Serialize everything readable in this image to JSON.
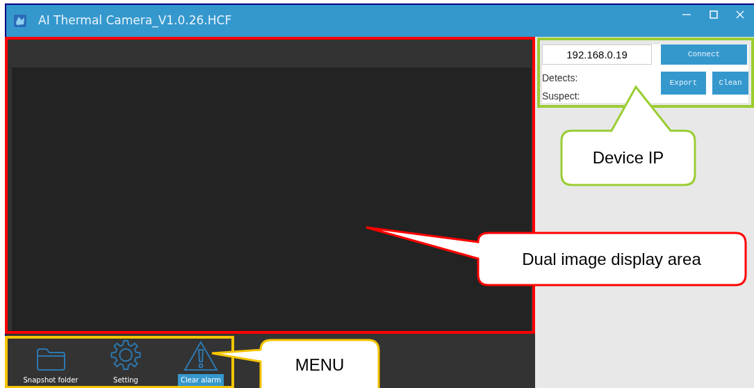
{
  "window": {
    "title": "AI Thermal Camera_V1.0.26.HCF"
  },
  "device": {
    "ip": "192.168.0.19",
    "connect": "Connect",
    "detects_label": "Detects:",
    "suspect_label": "Suspect:",
    "export": "Export",
    "clean": "Clean"
  },
  "menu": [
    {
      "kind": "folder",
      "label": "Snapshot folder",
      "highlighted": false
    },
    {
      "kind": "gear",
      "label": "Setting",
      "highlighted": false
    },
    {
      "kind": "warning",
      "label": "Clear alarm",
      "highlighted": true
    }
  ],
  "callouts": [
    {
      "text": "Device IP",
      "color": "#9acd32"
    },
    {
      "text": "Dual image display area",
      "color": "#ff0000"
    },
    {
      "text": "MENU",
      "color": "#f5c400"
    }
  ]
}
